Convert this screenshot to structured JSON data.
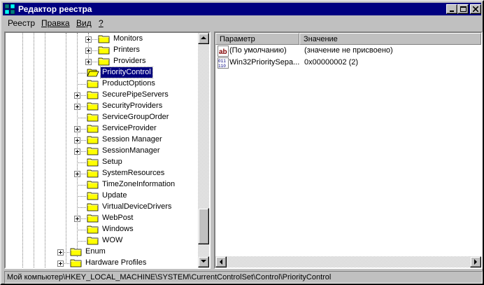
{
  "window": {
    "title": "Редактор реестра",
    "icon": "registry-editor-icon",
    "controls": [
      "minimize-icon",
      "maximize-icon",
      "close-icon"
    ]
  },
  "menu": [
    {
      "label": "Реестр"
    },
    {
      "label": "Правка"
    },
    {
      "label": "Вид"
    },
    {
      "label": "?"
    }
  ],
  "tree": {
    "items": [
      {
        "label": "Monitors",
        "expandable": true
      },
      {
        "label": "Printers",
        "expandable": true
      },
      {
        "label": "Providers",
        "expandable": true
      },
      {
        "label": "PriorityControl",
        "expandable": false,
        "selected": true,
        "open": true
      },
      {
        "label": "ProductOptions",
        "expandable": false
      },
      {
        "label": "SecurePipeServers",
        "expandable": true
      },
      {
        "label": "SecurityProviders",
        "expandable": true
      },
      {
        "label": "ServiceGroupOrder",
        "expandable": false
      },
      {
        "label": "ServiceProvider",
        "expandable": true
      },
      {
        "label": "Session Manager",
        "expandable": true
      },
      {
        "label": "SessionManager",
        "expandable": true
      },
      {
        "label": "Setup",
        "expandable": false
      },
      {
        "label": "SystemResources",
        "expandable": true
      },
      {
        "label": "TimeZoneInformation",
        "expandable": false
      },
      {
        "label": "Update",
        "expandable": false
      },
      {
        "label": "VirtualDeviceDrivers",
        "expandable": false
      },
      {
        "label": "WebPost",
        "expandable": true
      },
      {
        "label": "Windows",
        "expandable": false
      },
      {
        "label": "WOW",
        "expandable": false
      },
      {
        "label": "Enum",
        "expandable": true
      },
      {
        "label": "Hardware Profiles",
        "expandable": true
      }
    ]
  },
  "list": {
    "columns": {
      "name": "Параметр",
      "data": "Значение"
    },
    "rows": [
      {
        "name": "(По умолчанию)",
        "data": "(значение не присвоено)",
        "icon": "string-value-icon"
      },
      {
        "name": "Win32PrioritySepa...",
        "data": "0x00000002 (2)",
        "icon": "dword-value-icon"
      }
    ]
  },
  "status": {
    "path": "Мой компьютер\\HKEY_LOCAL_MACHINE\\SYSTEM\\CurrentControlSet\\Control\\PriorityControl"
  },
  "colors": {
    "titlebar": "#000080",
    "face": "#c0c0c0",
    "selection": "#000080",
    "folder": "#ffff00"
  }
}
